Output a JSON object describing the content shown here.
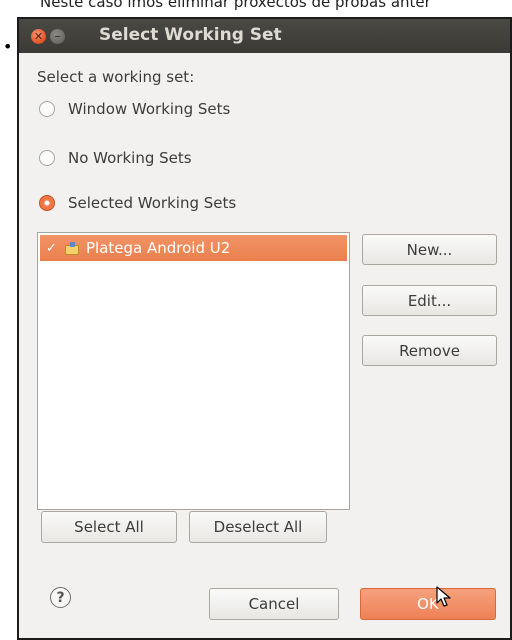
{
  "background_caption": "Neste caso imos eliminar proxectos de probas anter",
  "dialog": {
    "title": "Select Working Set",
    "close_glyph": "✕",
    "minimize_glyph": "–",
    "section_label": "Select a working set:",
    "radio_options": [
      {
        "label": "Window Working Sets",
        "checked": false
      },
      {
        "label": "No Working Sets",
        "checked": false
      },
      {
        "label": "Selected Working Sets",
        "checked": true
      }
    ],
    "working_sets": [
      {
        "label": "Platega Android U2",
        "checked": true,
        "selected": true
      }
    ],
    "side_buttons": {
      "new": "New...",
      "edit": "Edit...",
      "remove": "Remove"
    },
    "select_all_label": "Select All",
    "deselect_all_label": "Deselect All",
    "help_glyph": "?",
    "cancel_label": "Cancel",
    "ok_label": "OK"
  },
  "colors": {
    "titlebar": "#3c3b37",
    "dialog_bg": "#f2f1f0",
    "selection": "#f07746",
    "primary_button": "#f0875c"
  }
}
